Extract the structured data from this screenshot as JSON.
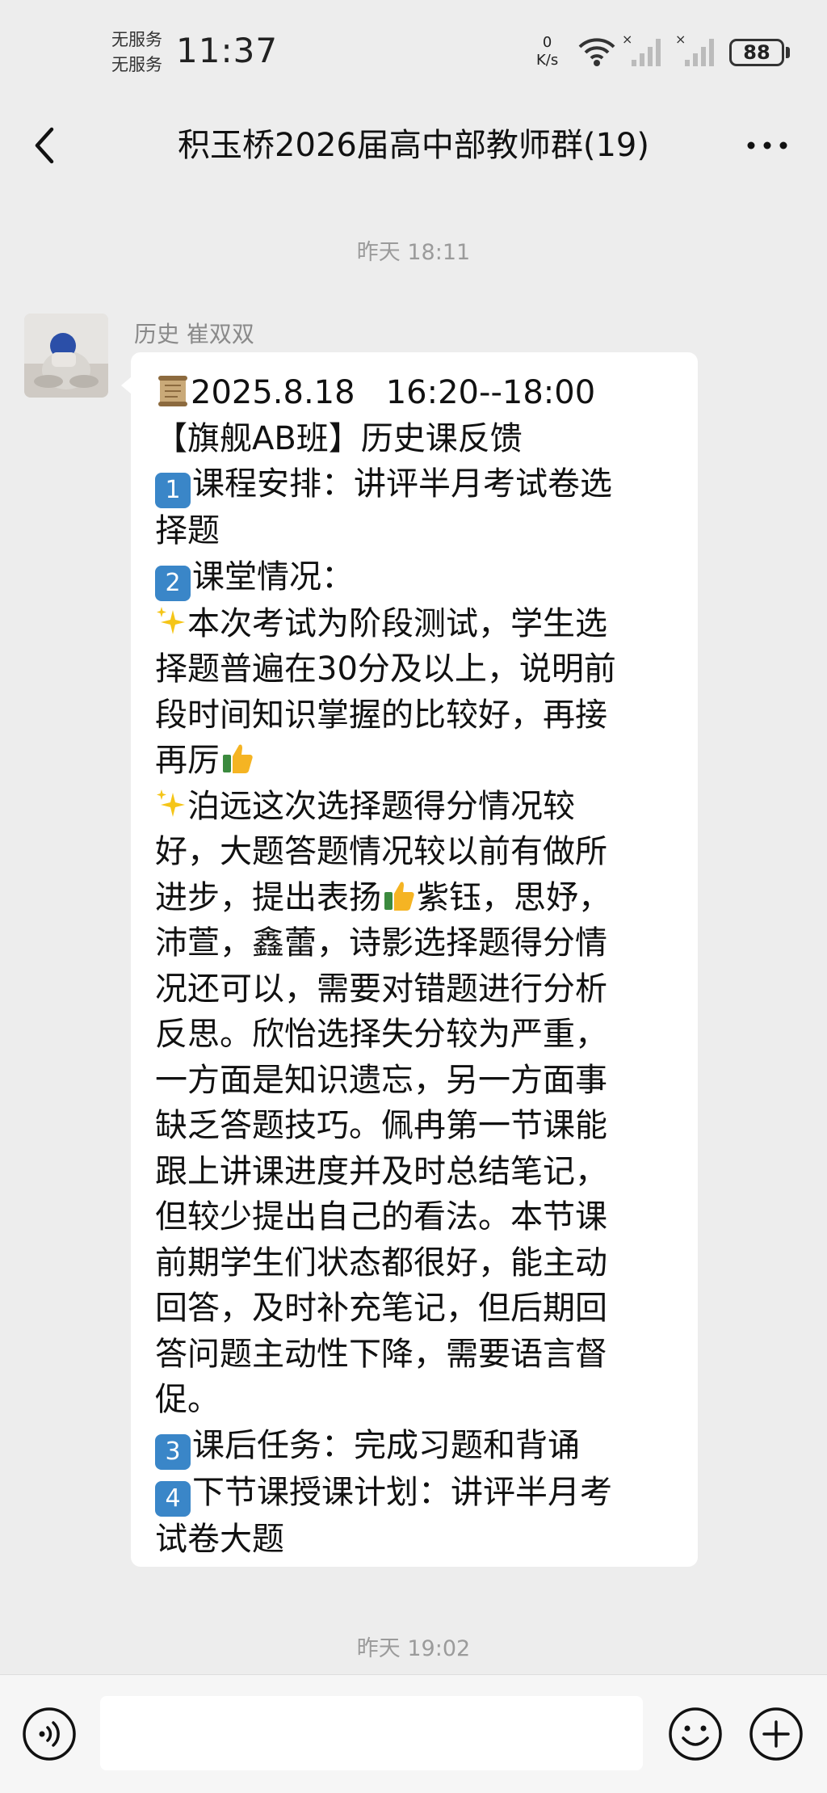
{
  "status_bar": {
    "carrier_1": "无服务",
    "carrier_2": "无服务",
    "time": "11:37",
    "net_speed_value": "0",
    "net_speed_unit": "K/s",
    "battery": "88"
  },
  "nav": {
    "title": "积玉桥2026届高中部教师群(19)"
  },
  "chat": {
    "timestamp_1": "昨天 18:11",
    "sender": "历史 崔双双",
    "message": {
      "date": "2025.8.18",
      "time_range": "16:20--18:00",
      "lines": [
        "【旗舰AB班】历史课反馈",
        "课程安排：讲评半月考试卷选",
        "择题",
        "课堂情况：",
        "本次考试为阶段测试，学生选",
        "择题普遍在30分及以上，说明前",
        "段时间知识掌握的比较好，再接",
        "再厉",
        "泊远这次选择题得分情况较",
        "好，大题答题情况较以前有做所",
        "进步，提出表扬",
        "紫钰，思妤，",
        "沛萱，鑫蕾，诗影选择题得分情",
        "况还可以，需要对错题进行分析",
        "反思。欣怡选择失分较为严重，",
        "一方面是知识遗忘，另一方面事",
        "缺乏答题技巧。佩冉第一节课能",
        "跟上讲课进度并及时总结笔记，",
        "但较少提出自己的看法。本节课",
        "前期学生们状态都很好，能主动",
        "回答，及时补充笔记，但后期回",
        "答问题主动性下降，需要语言督",
        "促。",
        "课后任务：完成习题和背诵",
        "下节课授课计划：讲评半月考",
        "试卷大题"
      ],
      "badges": [
        "1",
        "2",
        "3",
        "4"
      ]
    },
    "timestamp_2": "昨天 19:02"
  },
  "input_bar": {
    "placeholder": ""
  },
  "colors": {
    "background": "#ededed",
    "bubble": "#ffffff",
    "badge": "#3a86c8",
    "timestamp": "#9b9b9b"
  },
  "icons": [
    "back-icon",
    "more-icon",
    "wifi-icon",
    "signal-icon",
    "scroll-emoji-icon",
    "sparkles-icon",
    "thumbs-up-icon",
    "voice-icon",
    "emoji-icon",
    "plus-icon"
  ]
}
